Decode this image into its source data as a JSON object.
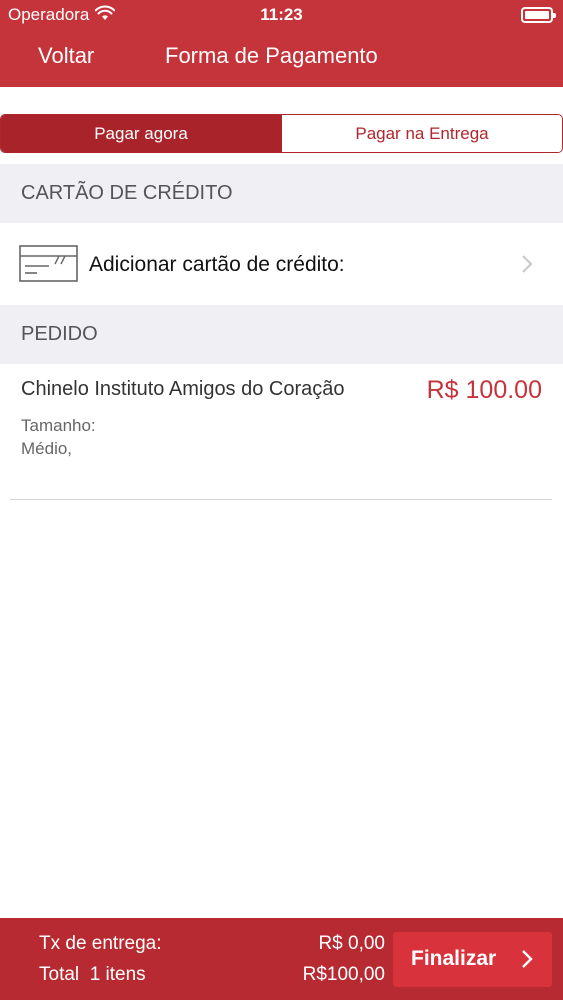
{
  "status_bar": {
    "carrier": "Operadora",
    "time": "11:23"
  },
  "nav": {
    "back_label": "Voltar",
    "title": "Forma de Pagamento"
  },
  "segmented": {
    "pay_now": "Pagar agora",
    "pay_on_delivery": "Pagar na Entrega"
  },
  "credit_card_section": {
    "header": "CARTÃO DE CRÉDITO",
    "add_card_label": "Adicionar cartão de crédito:"
  },
  "order_section": {
    "header": "PEDIDO",
    "item": {
      "name": "Chinelo Instituto Amigos do Coração",
      "price": "R$ 100.00",
      "size_label": "Tamanho:",
      "size_value": "Médio,"
    }
  },
  "footer": {
    "delivery_fee_label": "Tx de entrega:",
    "delivery_fee_value": "R$ 0,00",
    "total_label": "Total  1 itens",
    "total_value": "R$100,00",
    "finalize_label": "Finalizar"
  },
  "colors": {
    "brand_red": "#c5343b",
    "active_segment": "#a8242a",
    "footer_bg": "#b72a31",
    "section_bg": "#efeff4"
  },
  "icons": [
    "wifi-icon",
    "battery-icon",
    "credit-card-icon",
    "chevron-right-icon"
  ]
}
